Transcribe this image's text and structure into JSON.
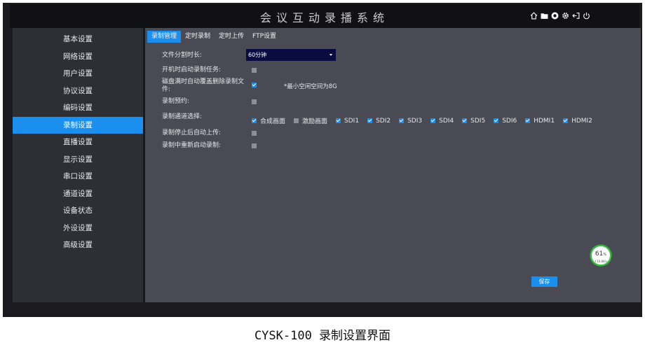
{
  "app": {
    "title": "会议互动录播系统",
    "top_icons": [
      "home-icon",
      "folder-icon",
      "record-icon",
      "settings-icon",
      "logout-icon",
      "power-icon"
    ]
  },
  "sidebar": {
    "items": [
      {
        "label": "基本设置",
        "active": false
      },
      {
        "label": "网络设置",
        "active": false
      },
      {
        "label": "用户设置",
        "active": false
      },
      {
        "label": "协议设置",
        "active": false
      },
      {
        "label": "编码设置",
        "active": false
      },
      {
        "label": "录制设置",
        "active": true
      },
      {
        "label": "直播设置",
        "active": false
      },
      {
        "label": "显示设置",
        "active": false
      },
      {
        "label": "串口设置",
        "active": false
      },
      {
        "label": "通道设置",
        "active": false
      },
      {
        "label": "设备状态",
        "active": false
      },
      {
        "label": "外设设置",
        "active": false
      },
      {
        "label": "高级设置",
        "active": false
      }
    ]
  },
  "tabs": [
    {
      "label": "录制管理",
      "active": true
    },
    {
      "label": "定时录制",
      "active": false
    },
    {
      "label": "定时上传",
      "active": false
    },
    {
      "label": "FTP设置",
      "active": false
    }
  ],
  "form": {
    "split_duration_label": "文件分割时长:",
    "split_duration_value": "60分钟",
    "auto_start_label": "开机时启动录制任务:",
    "auto_start_checked": false,
    "disk_full_label": "磁盘满时自动覆盖删除录制文件:",
    "disk_full_checked": true,
    "disk_full_note": "*最小空闲空间为8G",
    "reservation_label": "录制预约:",
    "reservation_checked": false,
    "channel_select_label": "录制通道选择:",
    "channels": [
      {
        "label": "合成画面",
        "checked": true
      },
      {
        "label": "激励画面",
        "checked": false
      },
      {
        "label": "SDI1",
        "checked": true
      },
      {
        "label": "SDI2",
        "checked": true
      },
      {
        "label": "SDI3",
        "checked": true
      },
      {
        "label": "SDI4",
        "checked": true
      },
      {
        "label": "SDI5",
        "checked": true
      },
      {
        "label": "SDI6",
        "checked": true
      },
      {
        "label": "HDMI1",
        "checked": true
      },
      {
        "label": "HDMI2",
        "checked": true
      }
    ],
    "auto_upload_label": "录制停止后自动上传:",
    "auto_upload_checked": false,
    "restart_label": "录制中重新启动录制:",
    "restart_checked": false
  },
  "save_label": "保存",
  "gauge": {
    "percent": "61",
    "percent_unit": "%",
    "speed": "↑10.8K/s"
  },
  "caption": "CYSK-100 录制设置界面",
  "colors": {
    "accent": "#1b8fee",
    "panel": "#4a4a54",
    "sidebar": "#2e2e35",
    "select_bg": "#0a0b40"
  }
}
